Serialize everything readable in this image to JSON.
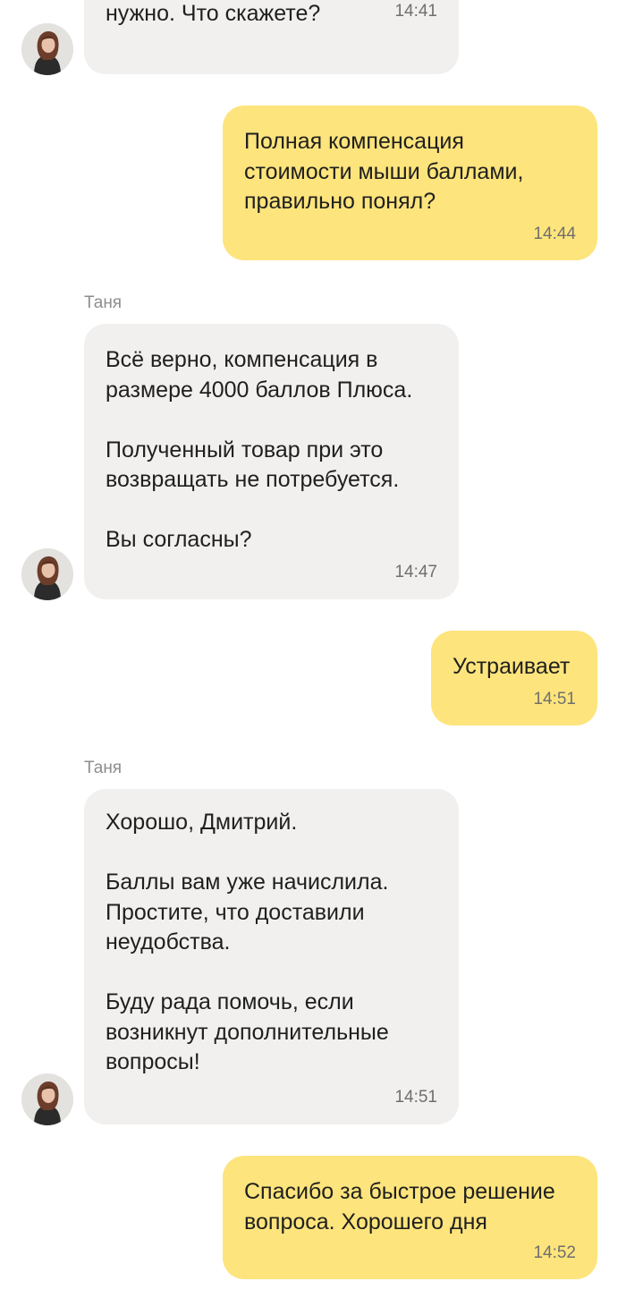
{
  "chat": {
    "sender_name": "Таня",
    "messages": [
      {
        "direction": "in",
        "text": "нужно. Что скажете?",
        "time": "14:41"
      },
      {
        "direction": "out",
        "text": "Полная компенсация\nстоимости мыши баллами,\nправильно понял?",
        "time": "14:44"
      },
      {
        "direction": "in",
        "text": "Всё верно, компенсация в\nразмере 4000 баллов Плюса.\n\nПолученный товар при это\nвозвращать не потребуется.\n\nВы согласны?",
        "time": "14:47"
      },
      {
        "direction": "out",
        "text": "Устраивает",
        "time": "14:51"
      },
      {
        "direction": "in",
        "text": "Хорошо, Дмитрий.\n\nБаллы вам уже начислила.\nПростите, что доставили\nнеудобства.\n\nБуду рада помочь, если\nвозникнут дополнительные\nвопросы!",
        "time": "14:51"
      },
      {
        "direction": "out",
        "text": "Спасибо за быстрое решение\nвопроса. Хорошего дня",
        "time": "14:52"
      }
    ]
  }
}
